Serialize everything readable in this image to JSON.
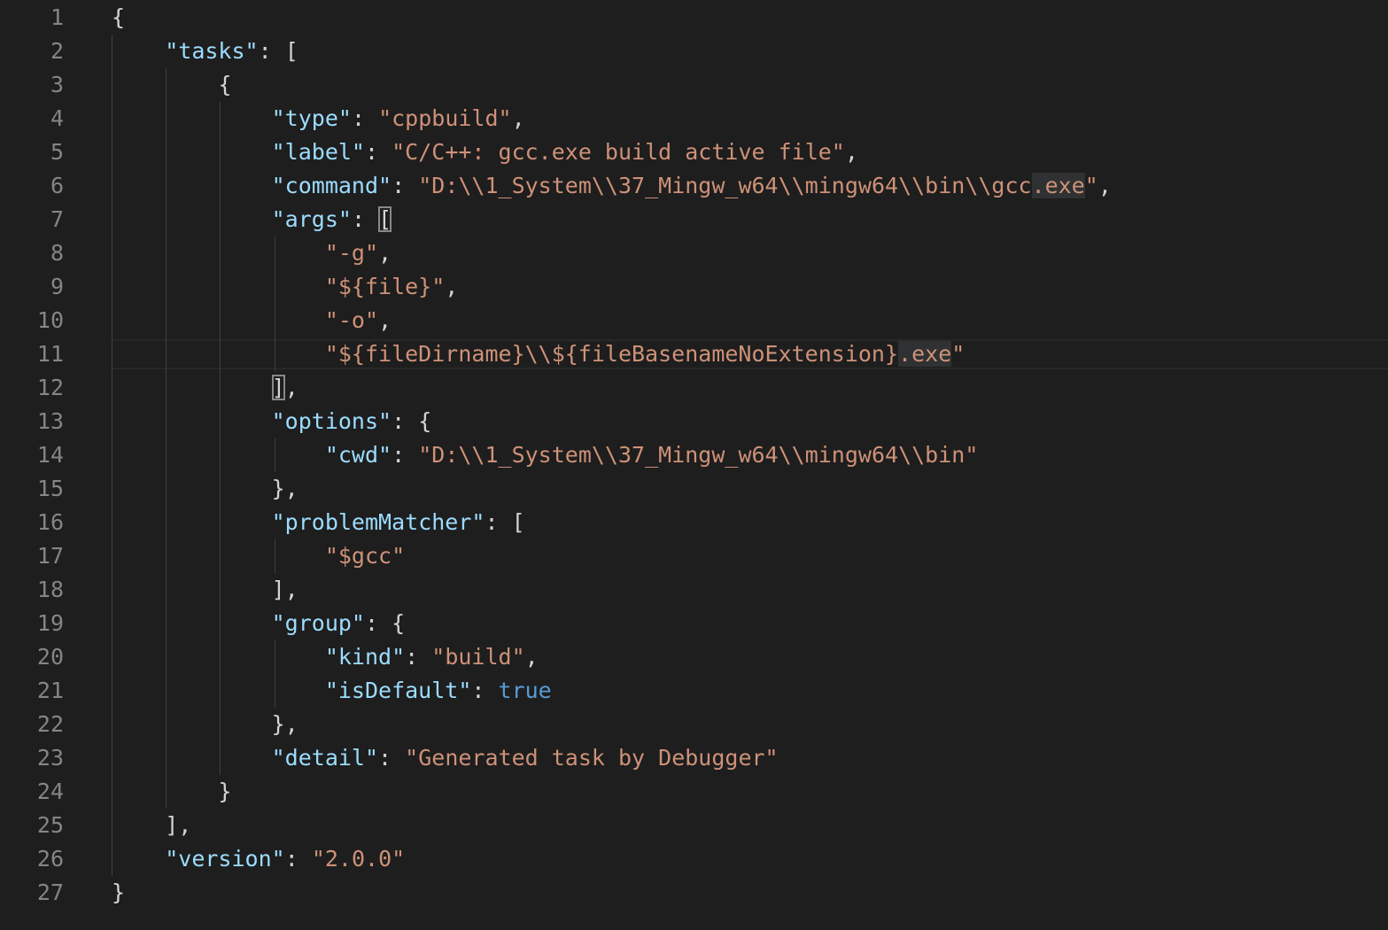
{
  "editor": {
    "theme_colors": {
      "background": "#1e1e1e",
      "line_number": "#858585",
      "key": "#9cdcfe",
      "string": "#ce9178",
      "boolean": "#569cd6",
      "punctuation": "#d4d4d4"
    },
    "current_line": 11,
    "lines": [
      {
        "n": "1",
        "text": "{"
      },
      {
        "n": "2",
        "text": "    \"tasks\": ["
      },
      {
        "n": "3",
        "text": "        {"
      },
      {
        "n": "4",
        "text": "            \"type\": \"cppbuild\","
      },
      {
        "n": "5",
        "text": "            \"label\": \"C/C++: gcc.exe build active file\","
      },
      {
        "n": "6",
        "text": "            \"command\": \"D:\\\\1_System\\\\37_Mingw_w64\\\\mingw64\\\\bin\\\\gcc.exe\","
      },
      {
        "n": "7",
        "text": "            \"args\": ["
      },
      {
        "n": "8",
        "text": "                \"-g\","
      },
      {
        "n": "9",
        "text": "                \"${file}\","
      },
      {
        "n": "10",
        "text": "                \"-o\","
      },
      {
        "n": "11",
        "text": "                \"${fileDirname}\\\\${fileBasenameNoExtension}.exe\""
      },
      {
        "n": "12",
        "text": "            ],"
      },
      {
        "n": "13",
        "text": "            \"options\": {"
      },
      {
        "n": "14",
        "text": "                \"cwd\": \"D:\\\\1_System\\\\37_Mingw_w64\\\\mingw64\\\\bin\""
      },
      {
        "n": "15",
        "text": "            },"
      },
      {
        "n": "16",
        "text": "            \"problemMatcher\": ["
      },
      {
        "n": "17",
        "text": "                \"$gcc\""
      },
      {
        "n": "18",
        "text": "            ],"
      },
      {
        "n": "19",
        "text": "            \"group\": {"
      },
      {
        "n": "20",
        "text": "                \"kind\": \"build\","
      },
      {
        "n": "21",
        "text": "                \"isDefault\": true"
      },
      {
        "n": "22",
        "text": "            },"
      },
      {
        "n": "23",
        "text": "            \"detail\": \"Generated task by Debugger\""
      },
      {
        "n": "24",
        "text": "        }"
      },
      {
        "n": "25",
        "text": "    ],"
      },
      {
        "n": "26",
        "text": "    \"version\": \"2.0.0\""
      },
      {
        "n": "27",
        "text": "}"
      }
    ]
  }
}
